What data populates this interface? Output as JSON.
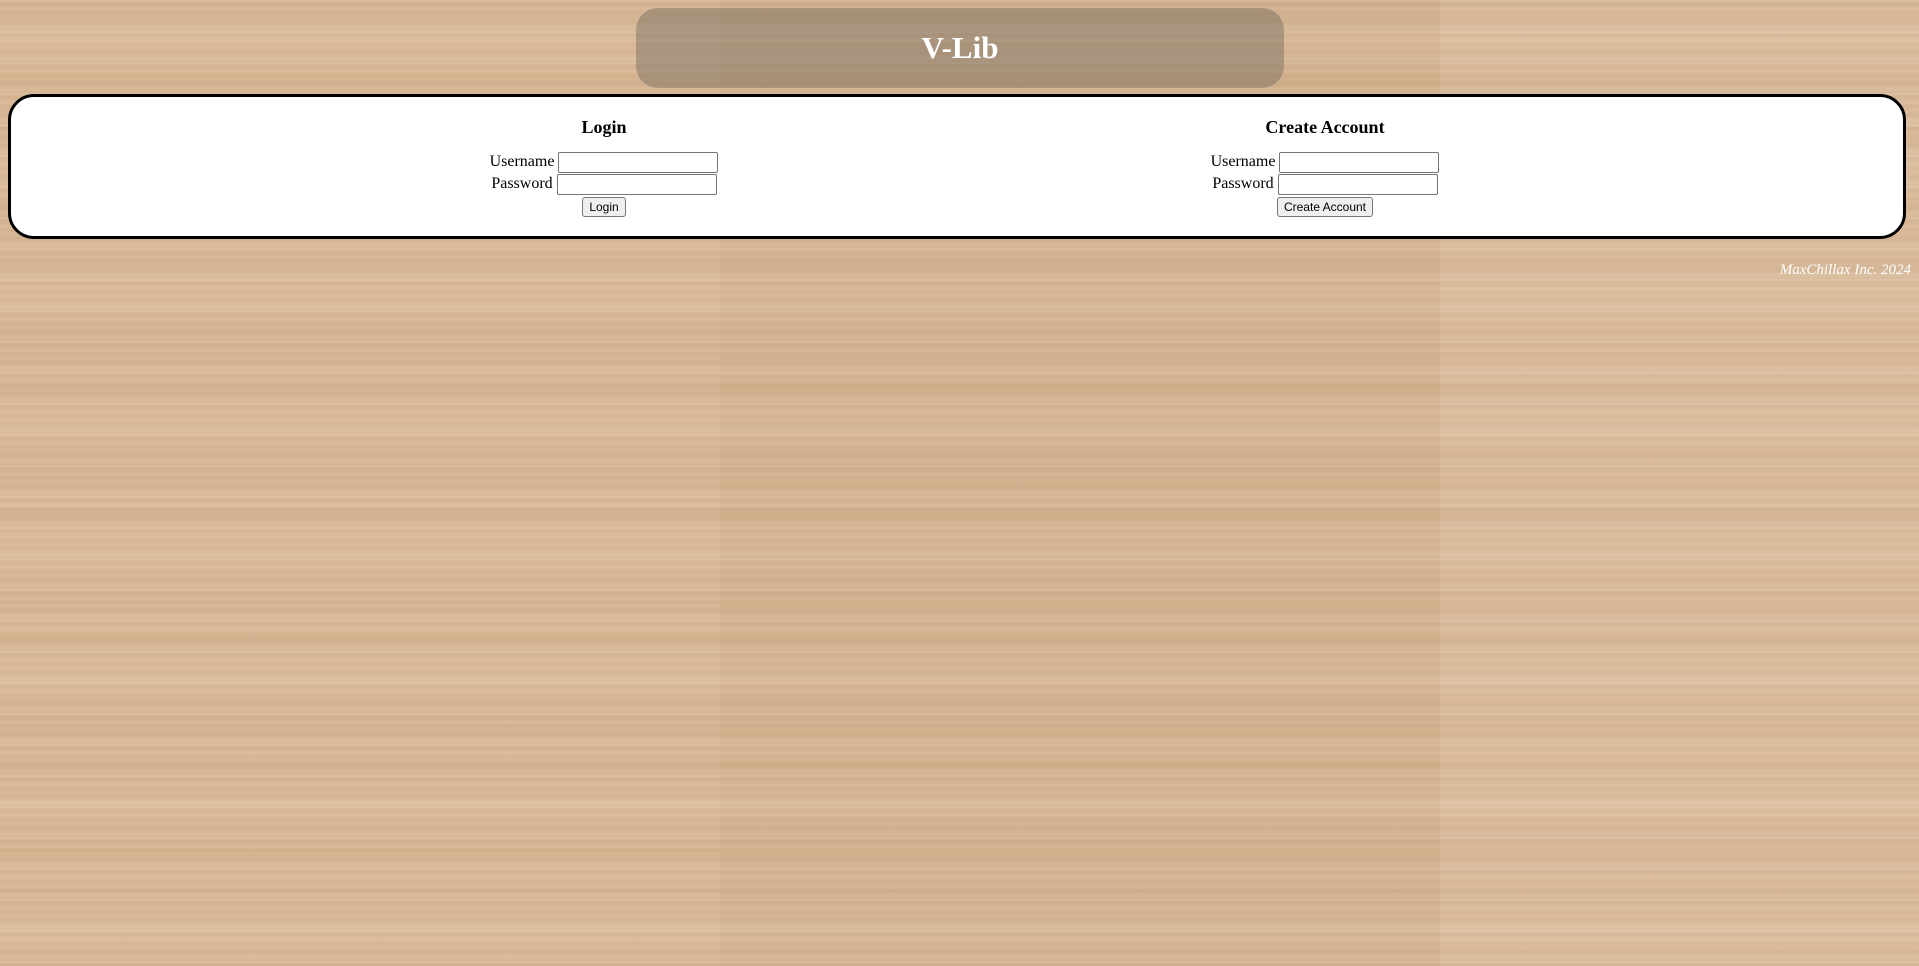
{
  "header": {
    "title": "V-Lib"
  },
  "login": {
    "heading": "Login",
    "username_label": "Username",
    "username_value": "",
    "password_label": "Password",
    "password_value": "",
    "button_label": "Login"
  },
  "create_account": {
    "heading": "Create Account",
    "username_label": "Username",
    "username_value": "",
    "password_label": "Password",
    "password_value": "",
    "button_label": "Create Account"
  },
  "footer": {
    "credit": "MaxChillax Inc. 2024"
  },
  "colors": {
    "card_background": "#ffffff",
    "card_border": "#000000",
    "banner_text": "#ffffff"
  }
}
